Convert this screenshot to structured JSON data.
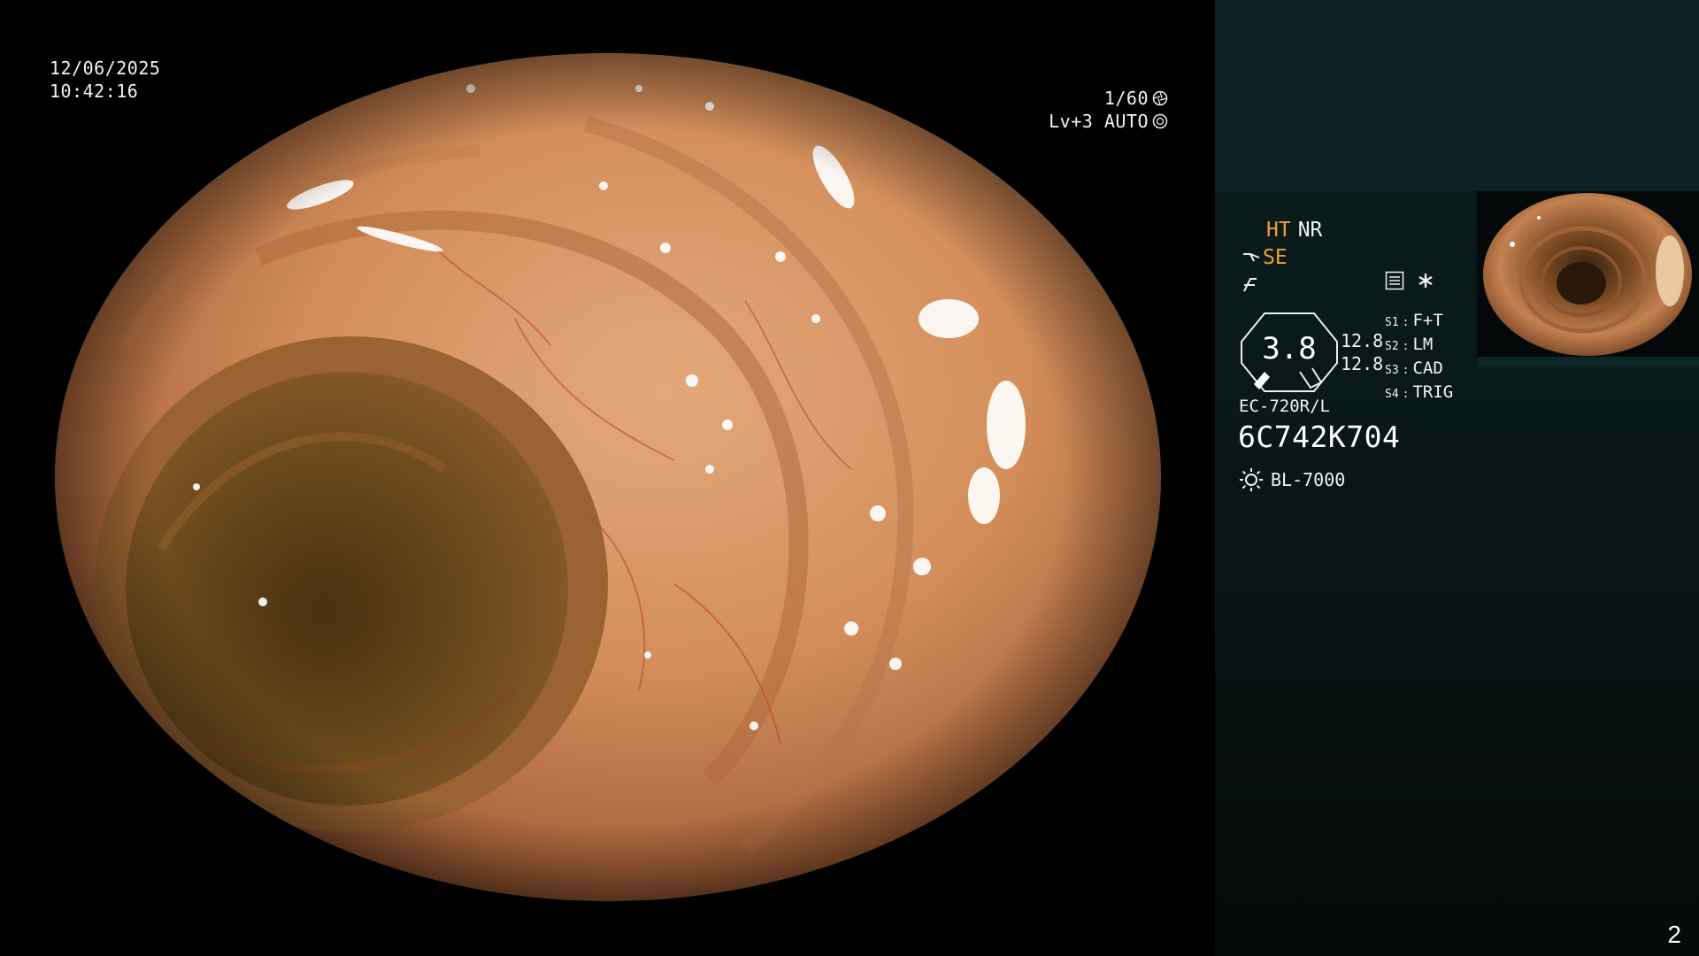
{
  "overlay": {
    "date": "12/06/2025",
    "time": "10:42:16",
    "shutter": "1/60",
    "exposure": "Lv+3 AUTO"
  },
  "panel": {
    "mode_ht": "HT",
    "mode_nr": "NR",
    "mode_se": "SE",
    "gauge_value": "3.8",
    "gauge_side_top": "12.8",
    "gauge_side_bottom": "12.8",
    "switches": [
      {
        "key": "S1",
        "value": "F+T"
      },
      {
        "key": "S2",
        "value": "LM"
      },
      {
        "key": "S3",
        "value": "CAD"
      },
      {
        "key": "S4",
        "value": "TRIG"
      }
    ],
    "scope_model": "EC-720R/L",
    "serial": "6C742K704",
    "light_source": "BL-7000",
    "page_number": "2"
  },
  "icons": {
    "shutter_icon": "aperture-icon",
    "auto_icon": "iris-icon",
    "settings_icon": "menu-list-icon",
    "star_icon": "asterisk-icon",
    "lamp_icon": "sun-icon",
    "mode_icon": "enhancement-icon",
    "curve_icon": "curve-icon"
  },
  "colors": {
    "panel_bg": "#0a1414",
    "accent_orange": "#f0a030",
    "mucosa": "#c98a55"
  }
}
